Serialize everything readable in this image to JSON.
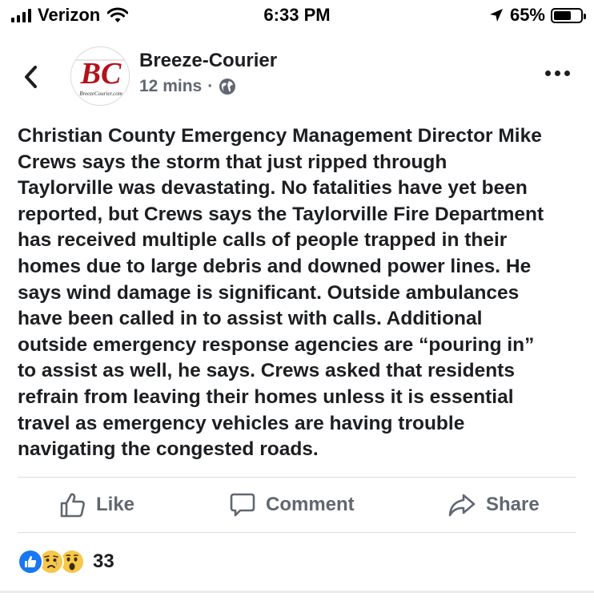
{
  "status_bar": {
    "carrier": "Verizon",
    "time": "6:33 PM",
    "battery_percent_label": "65%",
    "battery_level": 0.65
  },
  "post": {
    "page_name": "Breeze-Courier",
    "timestamp": "12 mins",
    "meta_separator": "·",
    "avatar": {
      "letters": "BC",
      "caption": "BreezeCourier.com",
      "brand_color": "#b3121b"
    },
    "body_lines": [
      "Christian County Emergency Management Director Mike",
      "Crews says the storm that just ripped through",
      "Taylorville was devastating. No fatalities have yet been",
      "reported, but Crews says the Taylorville Fire Department",
      "has received multiple calls of people trapped in their",
      "homes due to large debris and downed power lines. He",
      "says wind damage is significant. Outside ambulances",
      "have been called in to assist with calls. Additional",
      "outside emergency response agencies are “pouring in”",
      "to assist as well, he says. Crews asked that residents",
      "refrain from leaving their homes unless it is essential",
      "travel as emergency vehicles are having trouble",
      "navigating the congested roads."
    ]
  },
  "actions": {
    "like_label": "Like",
    "comment_label": "Comment",
    "share_label": "Share"
  },
  "reactions": {
    "types": [
      "like",
      "sad",
      "wow"
    ],
    "count": "33"
  },
  "colors": {
    "text": "#1c1e21",
    "secondary_text": "#606770",
    "like_blue": "#1877f2",
    "emoji_yellow": "#f7c74a",
    "divider": "#dadde1"
  },
  "icons": [
    "signal-icon",
    "wifi-icon",
    "location-arrow-icon",
    "battery-icon",
    "back-chevron-icon",
    "globe-icon",
    "more-dots-icon",
    "thumbs-up-icon",
    "comment-bubble-icon",
    "share-arrow-icon",
    "like-reaction-icon",
    "sad-reaction-icon",
    "wow-reaction-icon"
  ]
}
